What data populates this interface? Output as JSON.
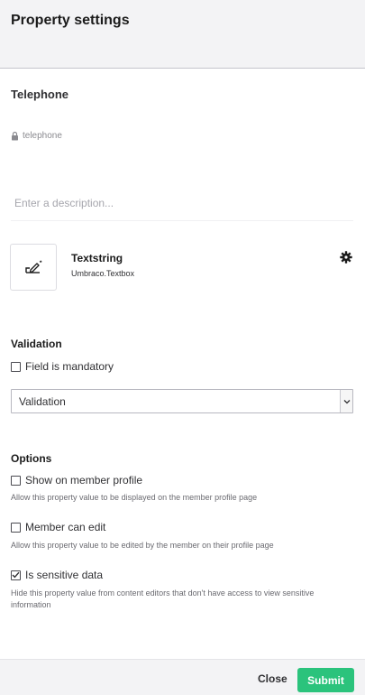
{
  "header": {
    "title": "Property settings"
  },
  "property": {
    "name": "Telephone",
    "alias": "telephone",
    "description_placeholder": "Enter a description..."
  },
  "editor": {
    "name": "Textstring",
    "alias": "Umbraco.Textbox",
    "icon": "pencil-edit-icon",
    "settings_icon": "gear-icon"
  },
  "validation": {
    "title": "Validation",
    "mandatory_label": "Field is mandatory",
    "mandatory_checked": false,
    "select_value": "Validation"
  },
  "options": {
    "title": "Options",
    "items": [
      {
        "label": "Show on member profile",
        "help": "Allow this property value to be displayed on the member profile page",
        "checked": false
      },
      {
        "label": "Member can edit",
        "help": "Allow this property value to be edited by the member on their profile page",
        "checked": false
      },
      {
        "label": "Is sensitive data",
        "help": "Hide this property value from content editors that don't have access to view sensitive information",
        "checked": true
      }
    ]
  },
  "footer": {
    "close_label": "Close",
    "submit_label": "Submit"
  },
  "colors": {
    "accent": "#2bc37c",
    "header_bg": "#f3f3f5"
  }
}
